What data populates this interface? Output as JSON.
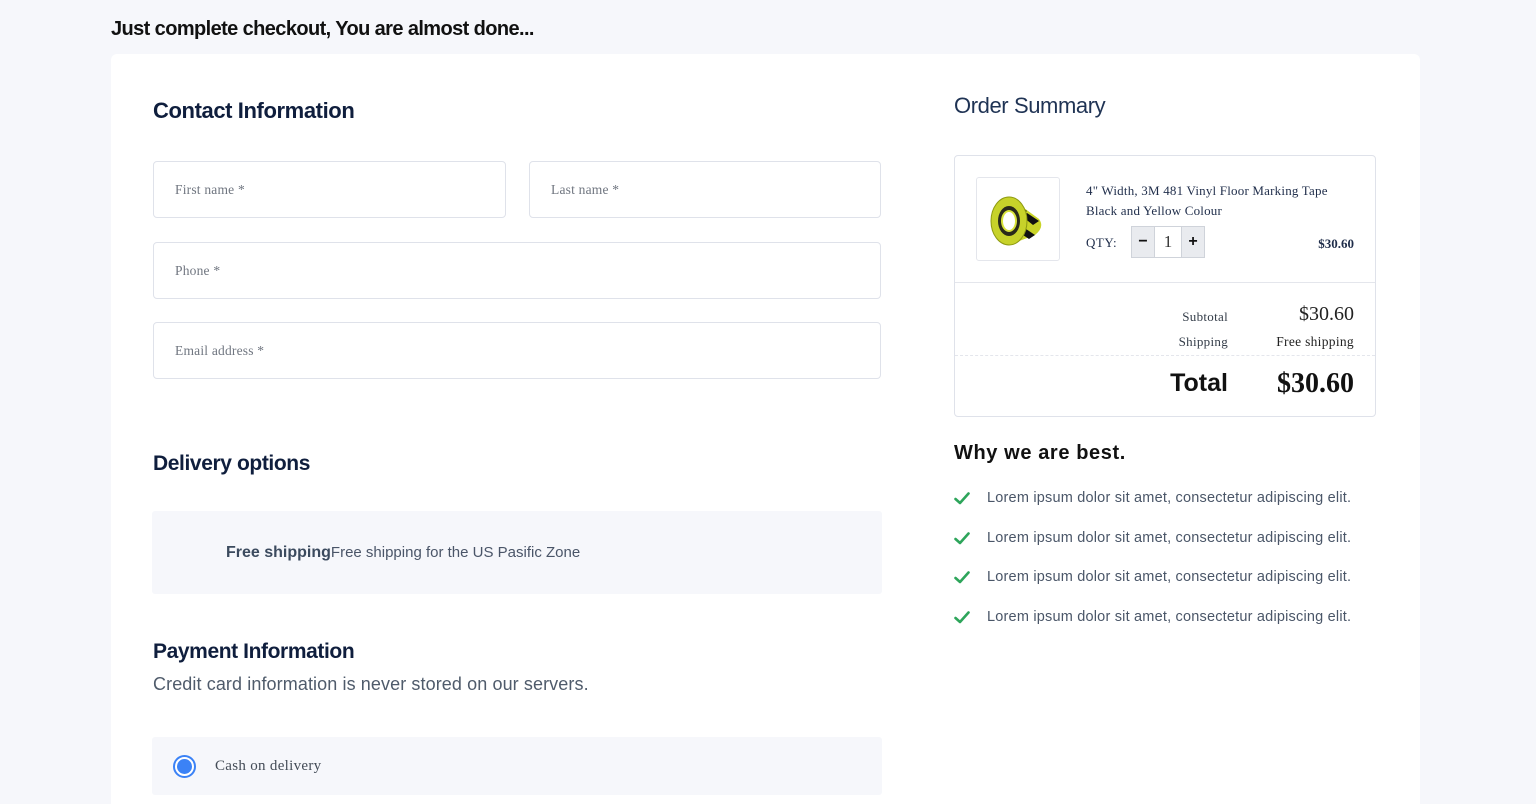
{
  "page_heading": "Just complete checkout, You are almost done...",
  "contact": {
    "title": "Contact Information",
    "first_name_placeholder": "First name *",
    "last_name_placeholder": "Last name *",
    "phone_placeholder": "Phone *",
    "email_placeholder": "Email address *"
  },
  "delivery": {
    "title": "Delivery options",
    "option_name": "Free shipping",
    "option_desc": "Free shipping for the US Pasific Zone"
  },
  "payment": {
    "title": "Payment Information",
    "subtitle": "Credit card information is never stored on our servers.",
    "option_label": "Cash on delivery",
    "option_selected": true
  },
  "summary": {
    "title": "Order Summary",
    "product": {
      "name": "4\" Width, 3M 481 Vinyl Floor Marking Tape Black and Yellow Colour",
      "qty_label": "QTY:",
      "qty": "1",
      "decrement": "−",
      "increment": "+",
      "price": "$30.60"
    },
    "subtotal_label": "Subtotal",
    "subtotal_value": "$30.60",
    "shipping_label": "Shipping",
    "shipping_value": "Free shipping",
    "total_label": "Total",
    "total_value": "$30.60"
  },
  "why": {
    "title": "Why we are best.",
    "items": [
      "Lorem ipsum dolor sit amet, consectetur adipiscing elit.",
      "Lorem ipsum dolor sit amet, consectetur adipiscing elit.",
      "Lorem ipsum dolor sit amet, consectetur adipiscing elit.",
      "Lorem ipsum dolor sit amet, consectetur adipiscing elit."
    ]
  },
  "colors": {
    "accent_blue": "#3b82f6",
    "check_green": "#2ea55b",
    "page_bg": "#f6f7fb"
  },
  "icons": {
    "check": "check-icon",
    "radio": "radio-icon",
    "product": "tape-roll-image"
  }
}
